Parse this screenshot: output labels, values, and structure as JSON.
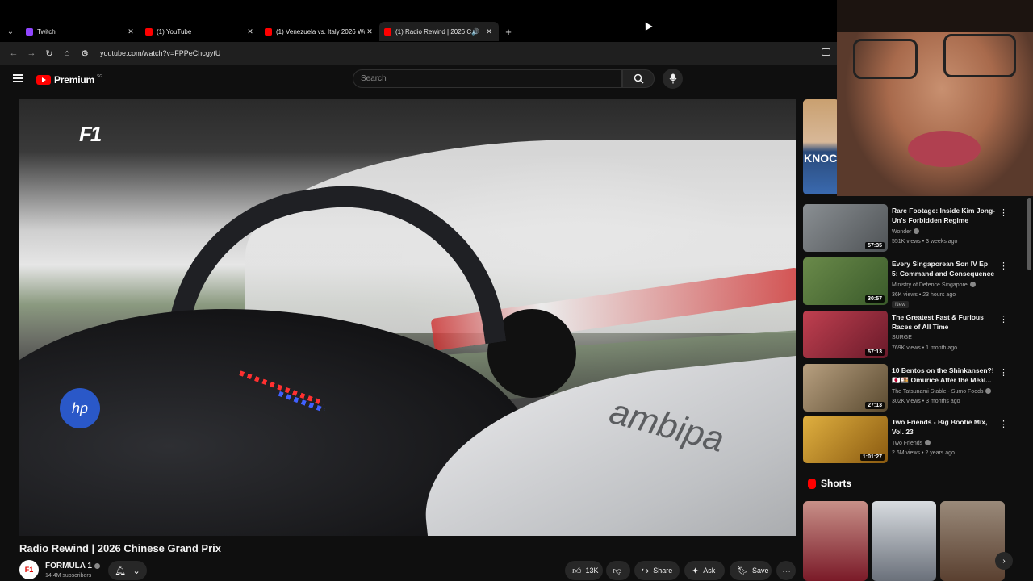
{
  "browser": {
    "tabs": [
      {
        "title": "Twitch",
        "favicon_color": "#9146ff",
        "active": false
      },
      {
        "title": "(1) YouTube",
        "favicon_color": "#ff0000",
        "active": false
      },
      {
        "title": "(1) Venezuela vs. Italy 2026 Wo",
        "favicon_color": "#ff0000",
        "active": false
      },
      {
        "title": "(1) Radio Rewind | 2026 Ch",
        "favicon_color": "#ff0000",
        "active": true,
        "audio": true
      }
    ],
    "url": "youtube.com/watch?v=FPPeChcgytU"
  },
  "header": {
    "logo_text": "Premium",
    "logo_region": "SG",
    "search_placeholder": "Search"
  },
  "video": {
    "overlay_logo": "F1",
    "sponsor_text": "ambipa",
    "badge_text": "hp",
    "title": "Radio Rewind | 2026 Chinese Grand Prix",
    "channel": "FORMULA 1",
    "channel_avatar_text": "F1",
    "subscribers": "14.4M subscribers",
    "actions": {
      "likes": "13K",
      "share": "Share",
      "ask": "Ask",
      "save": "Save"
    }
  },
  "sidebar": {
    "partial_thumb_text": "KNOC",
    "items": [
      {
        "title": "Rare Footage: Inside Kim Jong-Un's Forbidden Regime",
        "channel": "Wonder",
        "meta": "551K views • 3 weeks ago",
        "duration": "57:35",
        "thumb_color": "#6b6f72",
        "verified": true
      },
      {
        "title": "Every Singaporean Son IV Ep 5: Command and Consequence",
        "channel": "Ministry of Defence Singapore",
        "meta": "36K views • 23 hours ago",
        "duration": "30:57",
        "thumb_color": "#4a6a3a",
        "verified": true,
        "badge": "New"
      },
      {
        "title": "The Greatest Fast & Furious Races of All Time",
        "channel": "SURGE",
        "meta": "769K views • 1 month ago",
        "duration": "57:13",
        "thumb_color": "#9a2a3a",
        "verified": false
      },
      {
        "title": "10 Bentos on the Shinkansen?! 🇯🇵🍱 Omurice After the Meal...",
        "channel": "The Tatsunami Stable - Sumo Foods",
        "meta": "302K views • 3 months ago",
        "duration": "27:13",
        "thumb_color": "#8a7a5a",
        "verified": true
      },
      {
        "title": "Two Friends - Big Bootie Mix, Vol. 23",
        "channel": "Two Friends",
        "meta": "2.6M views • 2 years ago",
        "duration": "1:01:27",
        "thumb_color": "#b8862a",
        "verified": true
      }
    ],
    "shorts_label": "Shorts",
    "shorts": [
      {
        "color": "#6a2a30"
      },
      {
        "color": "#b8c0c8"
      },
      {
        "color": "#8a6a4a"
      }
    ]
  }
}
